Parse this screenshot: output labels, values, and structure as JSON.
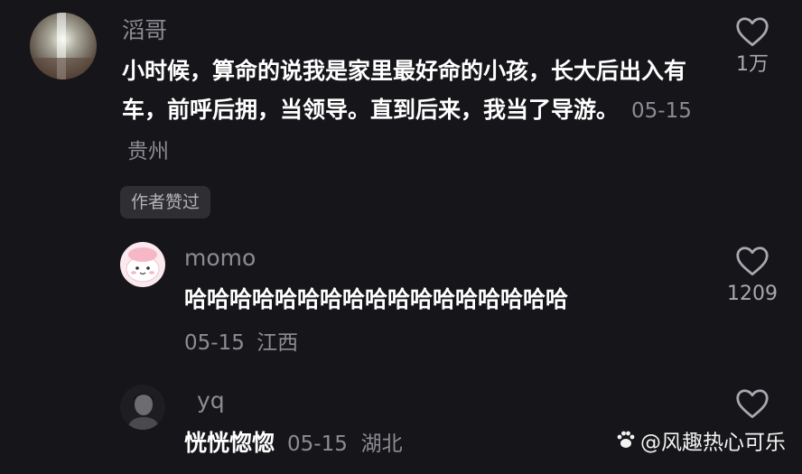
{
  "comments": [
    {
      "username": "滔哥",
      "text": "小时候，算命的说我是家里最好命的小孩，长大后出入有车，前呼后拥，当领导。直到后来，我当了导游。",
      "date": "05-15",
      "location": "贵州",
      "badge": "作者赞过",
      "likes": "1万",
      "avatar_icon": "photo-avatar"
    },
    {
      "username": "momo",
      "text": "哈哈哈哈哈哈哈哈哈哈哈哈哈哈哈哈哈",
      "date": "05-15",
      "location": "江西",
      "likes": "1209",
      "avatar_icon": "cartoon-avatar"
    },
    {
      "username": "yq",
      "text": "恍恍惚惚",
      "date": "05-15",
      "location": "湖北",
      "avatar_icon": "portrait-avatar"
    }
  ],
  "watermark": "@风趣热心可乐",
  "colors": {
    "background": "#16161a",
    "secondary_text": "#8c8c92",
    "badge_bg": "#2e2e33"
  }
}
